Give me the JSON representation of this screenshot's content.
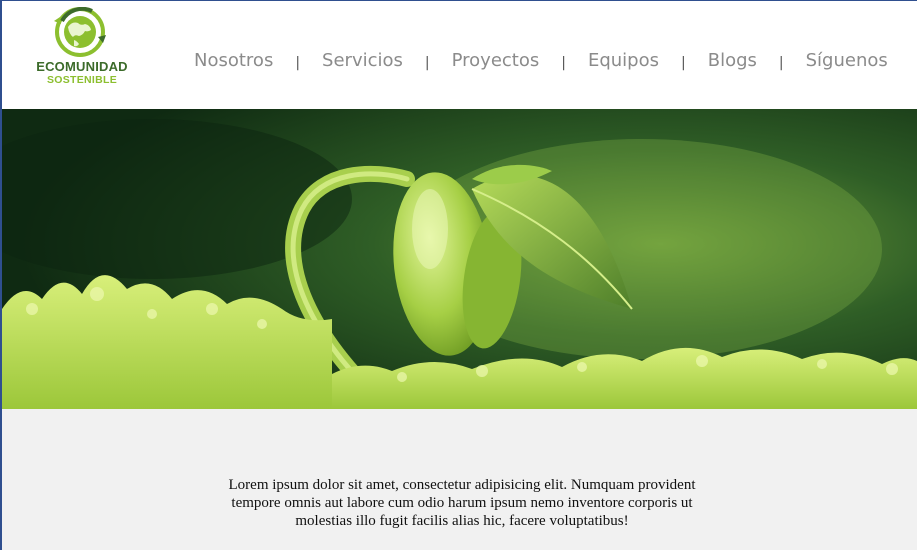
{
  "brand": {
    "line1": "ECOMUNIDAD",
    "line2": "SOSTENIBLE",
    "icon": "globe-recycle-icon",
    "colors": {
      "dark": "#3c6b2a",
      "light": "#8cbf2f"
    }
  },
  "nav": {
    "items": [
      {
        "label": "Nosotros"
      },
      {
        "label": "Servicios"
      },
      {
        "label": "Proyectos"
      },
      {
        "label": "Equipos"
      },
      {
        "label": "Blogs"
      },
      {
        "label": "Síguenos"
      }
    ],
    "separator": "|",
    "color": "#8b8b8b"
  },
  "hero": {
    "image": "sprouting-seedling-photo"
  },
  "content": {
    "paragraph": "Lorem ipsum dolor sit amet, consectetur adipisicing elit. Numquam provident tempore omnis aut labore cum odio harum ipsum nemo inventore corporis ut molestias illo fugit facilis alias hic, facere voluptatibus!",
    "background": "#f1f1f1"
  }
}
